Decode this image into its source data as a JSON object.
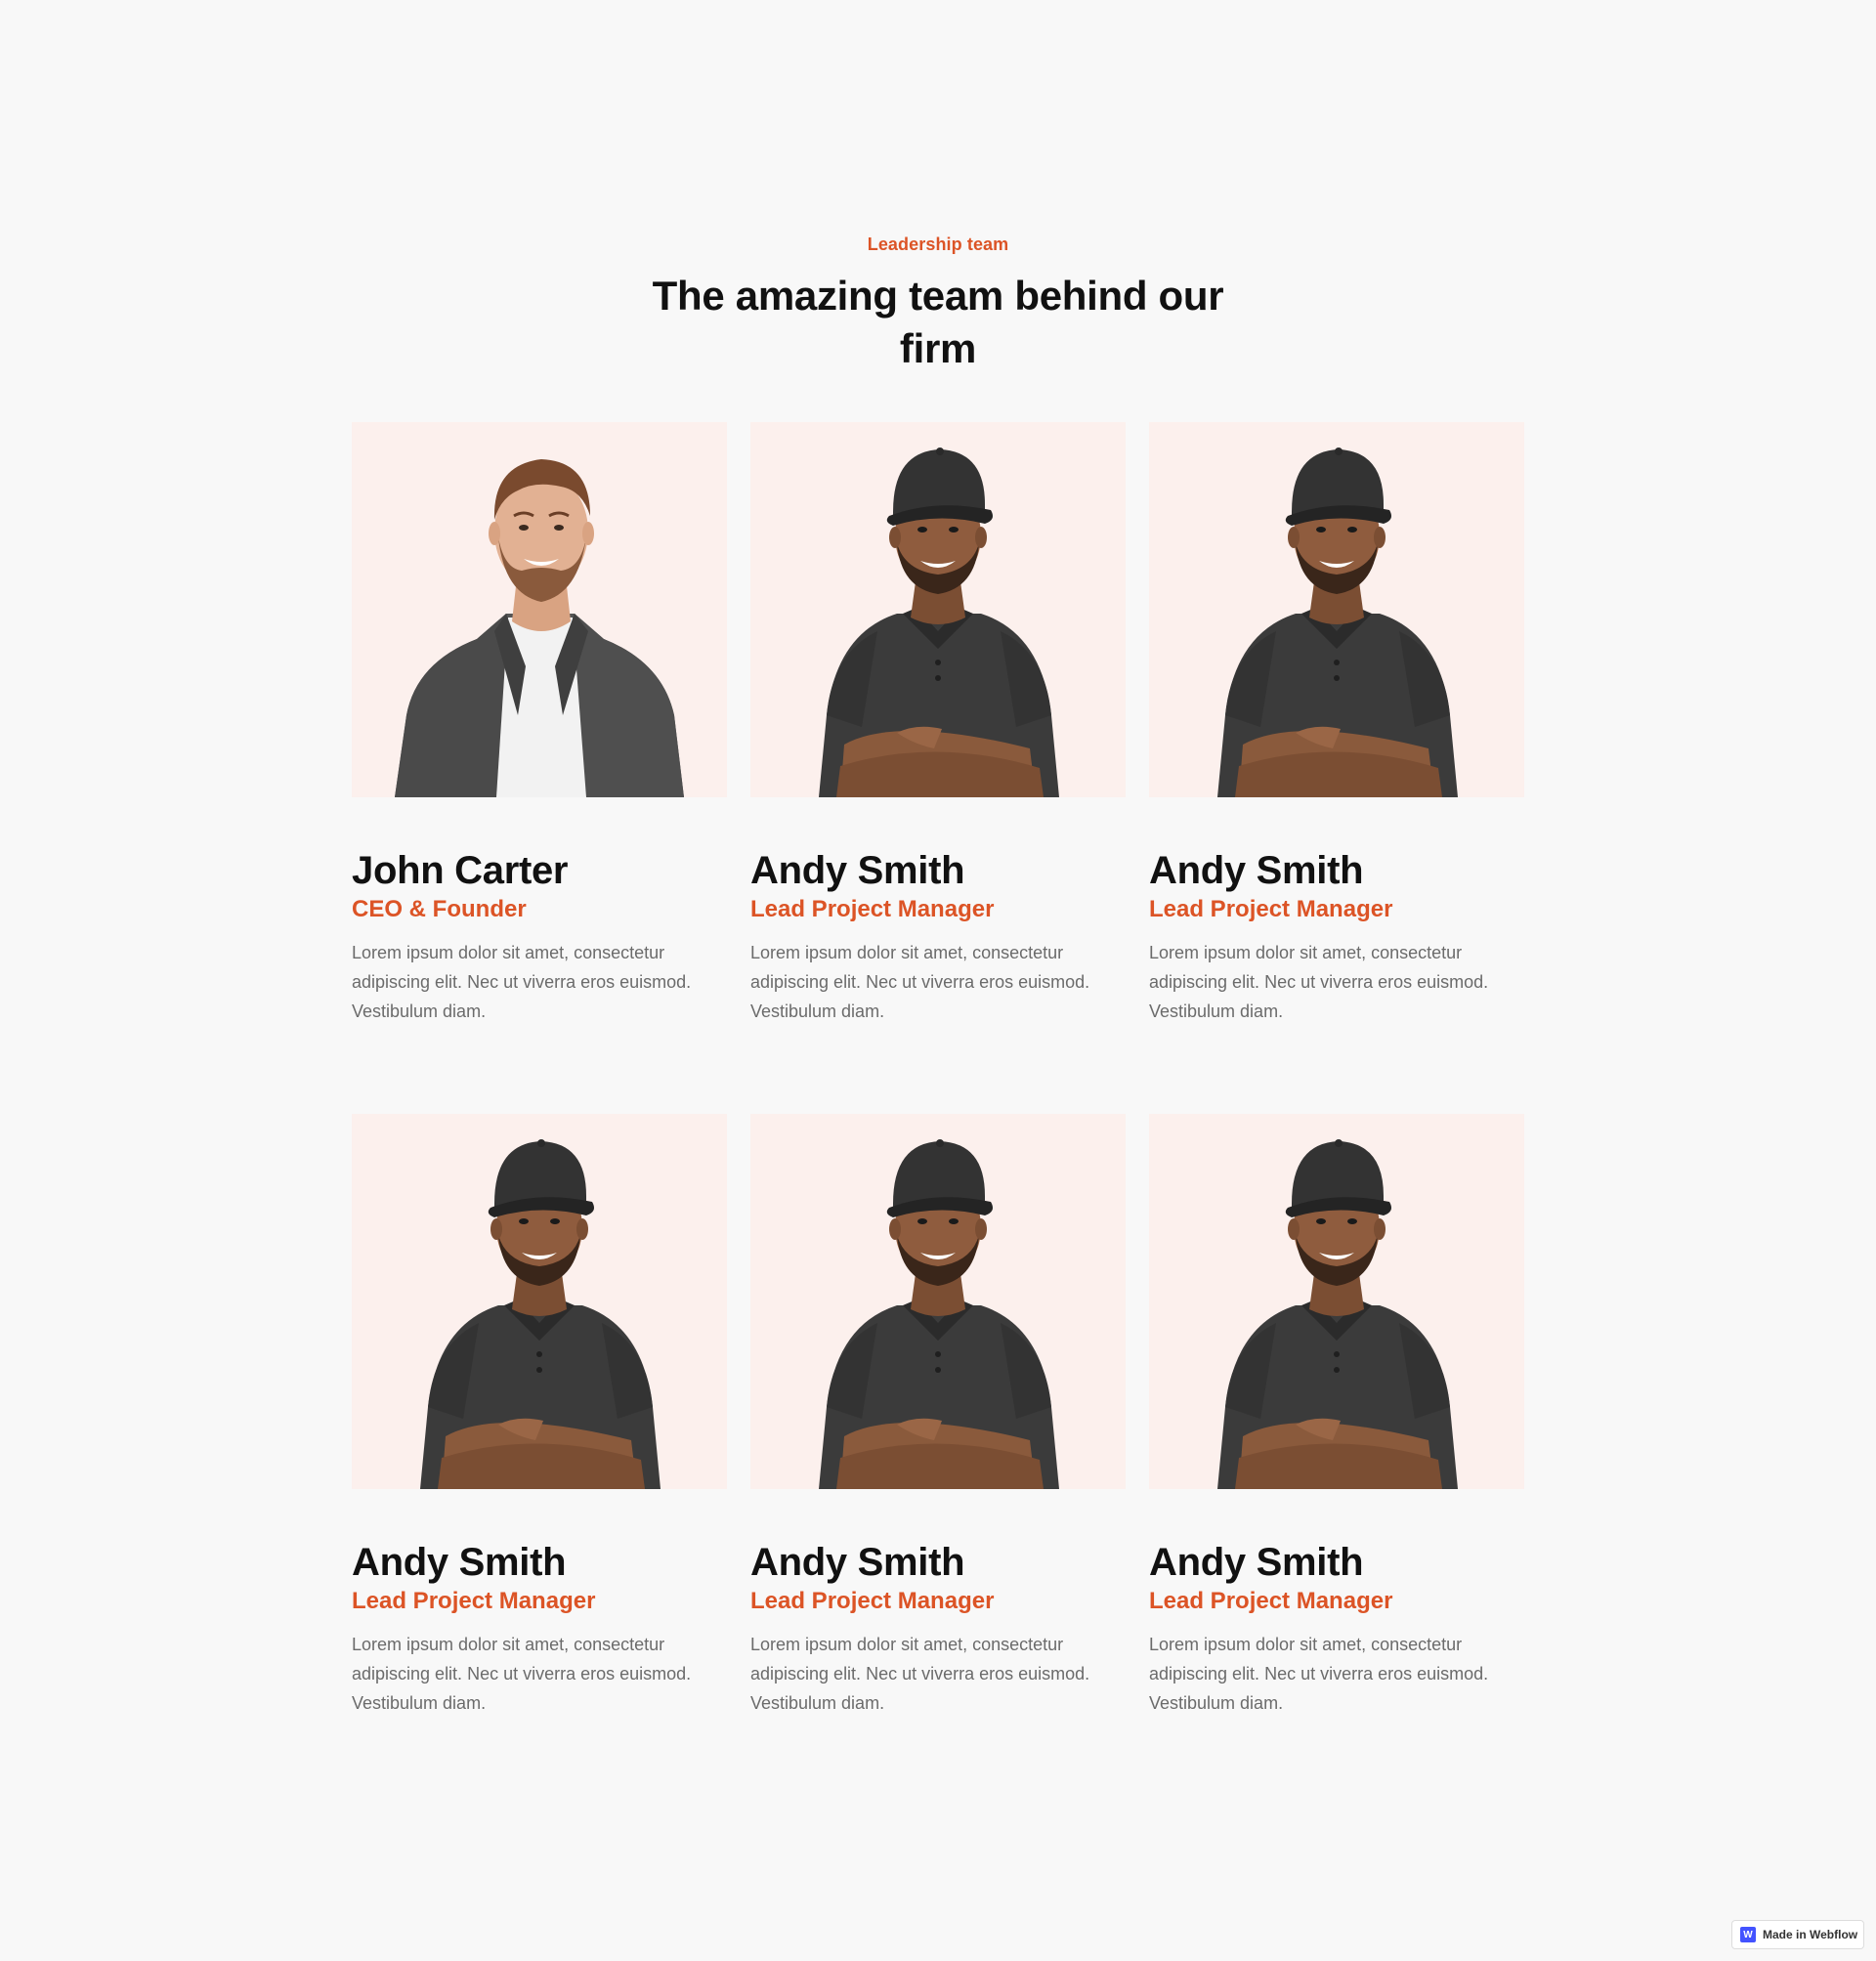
{
  "colors": {
    "background": "#f8f8f8",
    "accent": "#dc5426",
    "heading": "#111111",
    "body_text": "#6b6b6b",
    "photo_background": "#fcf0ed",
    "webflow_blue": "#4353ff"
  },
  "header": {
    "eyebrow": "Leadership team",
    "title": "The amazing team behind our firm"
  },
  "team": [
    {
      "name": "John Carter",
      "role": "CEO & Founder",
      "bio": "Lorem ipsum dolor sit amet, consectetur adipiscing elit. Nec ut viverra eros euismod. Vestibulum diam.",
      "photo": "man-in-grey-blazer-photo"
    },
    {
      "name": "Andy Smith",
      "role": "Lead Project Manager",
      "bio": "Lorem ipsum dolor sit amet, consectetur adipiscing elit. Nec ut viverra eros euismod. Vestibulum diam.",
      "photo": "man-in-cap-and-polo-photo"
    },
    {
      "name": "Andy Smith",
      "role": "Lead Project Manager",
      "bio": "Lorem ipsum dolor sit amet, consectetur adipiscing elit. Nec ut viverra eros euismod. Vestibulum diam.",
      "photo": "man-in-cap-and-polo-photo"
    },
    {
      "name": "Andy Smith",
      "role": "Lead Project Manager",
      "bio": "Lorem ipsum dolor sit amet, consectetur adipiscing elit. Nec ut viverra eros euismod. Vestibulum diam.",
      "photo": "man-in-cap-and-polo-photo"
    },
    {
      "name": "Andy Smith",
      "role": "Lead Project Manager",
      "bio": "Lorem ipsum dolor sit amet, consectetur adipiscing elit. Nec ut viverra eros euismod. Vestibulum diam.",
      "photo": "man-in-cap-and-polo-photo"
    },
    {
      "name": "Andy Smith",
      "role": "Lead Project Manager",
      "bio": "Lorem ipsum dolor sit amet, consectetur adipiscing elit. Nec ut viverra eros euismod. Vestibulum diam.",
      "photo": "man-in-cap-and-polo-photo"
    }
  ],
  "badge": {
    "label": "Made in Webflow",
    "logo_letter": "W",
    "icon": "webflow-logo-icon"
  }
}
